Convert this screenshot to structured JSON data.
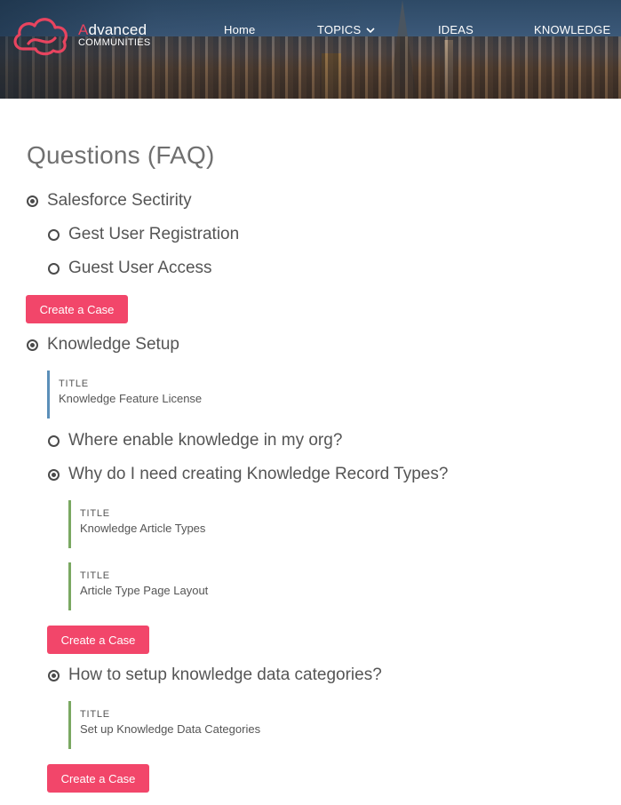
{
  "brand": {
    "logo_first": "A",
    "logo_rest": "dvanced",
    "logo_line2": "COMMUNITIES",
    "logo_color": "#e8445f"
  },
  "nav": {
    "home": "Home",
    "topics": "TOPICS",
    "ideas": "IDEAS",
    "knowledge": "KNOWLEDGE"
  },
  "page": {
    "title": "Questions (FAQ)"
  },
  "faq": {
    "topic1": {
      "label": "Salesforce Sectirity",
      "q1": "Gest User Registration",
      "q2": "Guest User Access",
      "button": "Create a Case"
    },
    "topic2": {
      "label": "Knowledge Setup",
      "card1": {
        "title": "TITLE",
        "value": "Knowledge Feature License"
      },
      "q1": "Where enable knowledge in my org?",
      "q2": "Why do I need creating Knowledge Record Types?",
      "q2_card1": {
        "title": "TITLE",
        "value": "Knowledge Article Types"
      },
      "q2_card2": {
        "title": "TITLE",
        "value": "Article Type Page Layout"
      },
      "q2_button": "Create a Case",
      "q3": "How to setup knowledge data categories?",
      "q3_card1": {
        "title": "TITLE",
        "value": "Set up Knowledge Data Categories"
      },
      "q3_button": "Create a Case"
    }
  },
  "colors": {
    "accent": "#f2466a",
    "blue_bar": "#5b8fb9",
    "green_bar": "#7aa862"
  }
}
